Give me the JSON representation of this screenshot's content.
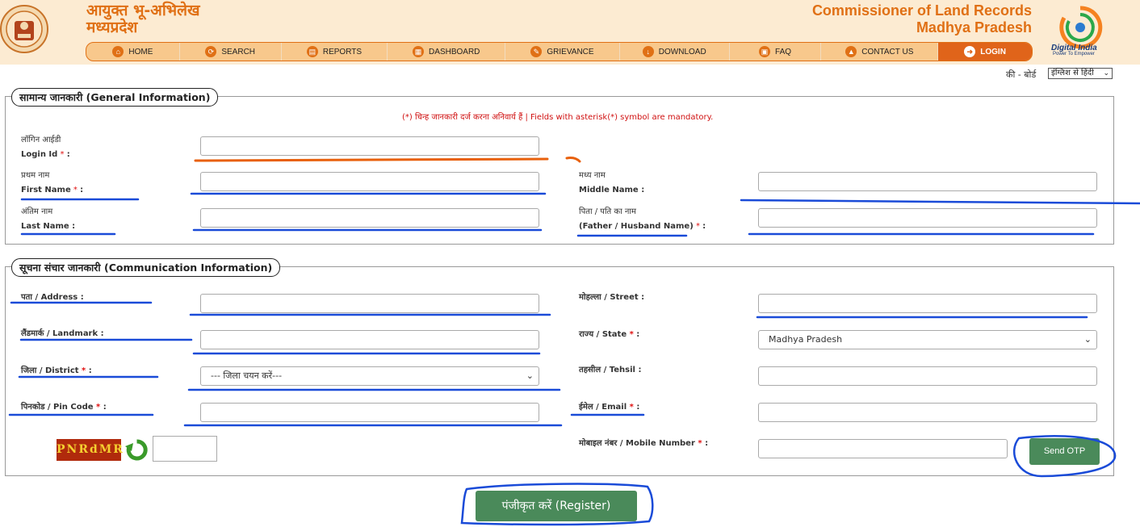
{
  "header": {
    "hindi_title_line1": "आयुक्त भू-अभिलेख",
    "hindi_title_line2": "मध्यप्रदेश",
    "english_title_line1": "Commissioner of Land Records",
    "english_title_line2": "Madhya Pradesh",
    "digital_india": "Digital India",
    "digital_india_tagline": "Power To Empower",
    "emblem_icon": "mp-state-emblem-icon",
    "accent_color": "#e07015"
  },
  "nav": {
    "items": [
      {
        "label": "HOME",
        "icon": "home-icon",
        "glyph": "⌂"
      },
      {
        "label": "SEARCH",
        "icon": "search-icon",
        "glyph": "⟳"
      },
      {
        "label": "REPORTS",
        "icon": "reports-icon",
        "glyph": "▤"
      },
      {
        "label": "DASHBOARD",
        "icon": "dashboard-icon",
        "glyph": "▦"
      },
      {
        "label": "GRIEVANCE",
        "icon": "grievance-icon",
        "glyph": "✎"
      },
      {
        "label": "DOWNLOAD",
        "icon": "download-icon",
        "glyph": "↓"
      },
      {
        "label": "FAQ",
        "icon": "faq-icon",
        "glyph": "▣"
      },
      {
        "label": "CONTACT US",
        "icon": "contact-icon",
        "glyph": "▲"
      },
      {
        "label": "LOGIN",
        "icon": "login-icon",
        "glyph": "➜"
      }
    ]
  },
  "keyboard": {
    "label": "की - बोर्ड",
    "selected": "इंग्लिश से हिंदी"
  },
  "general": {
    "legend": "सामान्य जानकारी (General Information)",
    "mandatory_note": "(*) चिन्ह जानकारी दर्ज करना अनिवार्य हैं | Fields with asterisk(*) symbol are mandatory.",
    "login_id_hi": "लॉगिन आईडी",
    "login_id_en": "Login Id",
    "first_name_hi": "प्रथम नाम",
    "first_name_en": "First Name",
    "middle_name_hi": "मध्य नाम",
    "middle_name_en": "Middle Name :",
    "last_name_hi": "अंतिम नाम",
    "last_name_en": "Last Name :",
    "father_hi": "पिता / पति का नाम",
    "father_en": "(Father / Husband Name)"
  },
  "communication": {
    "legend": "सूचना संचार जानकारी (Communication Information)",
    "address": "पता / Address :",
    "street": "मोहल्ला / Street :",
    "landmark": "लैंडमार्क / Landmark :",
    "state": "राज्य / State",
    "state_value": "Madhya Pradesh",
    "district": "जिला / District",
    "district_placeholder": "--- जिला चयन करें---",
    "tehsil": "तहसील / Tehsil :",
    "pincode": "पिनकोड / Pin Code",
    "email": "ईमेल / Email",
    "mobile": "मोबाइल नंबर / Mobile Number",
    "captcha_text": "PNRdMR",
    "send_otp": "Send OTP"
  },
  "register_label": "पंजीकृत करें   (Register)"
}
